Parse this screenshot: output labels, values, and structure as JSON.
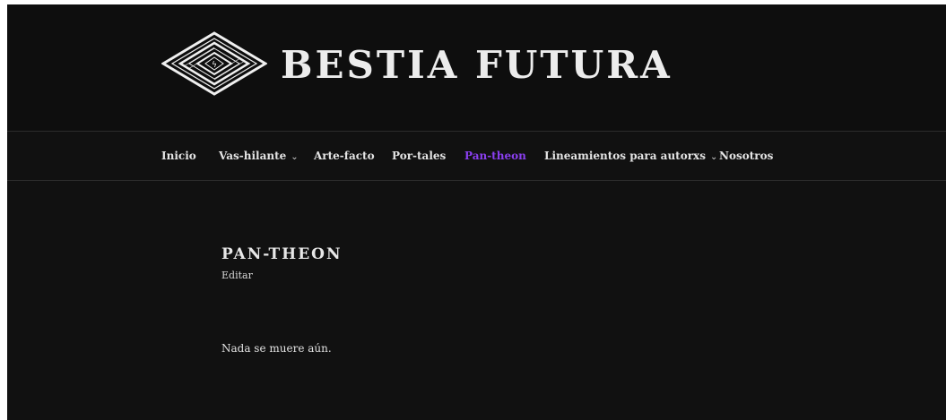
{
  "site": {
    "title": "BESTIA FUTURA",
    "logo_icon": "diamond-spiral-logo"
  },
  "nav": {
    "items": [
      {
        "label": "Inicio",
        "has_dropdown": false,
        "active": false
      },
      {
        "label": "Vas-hilante",
        "has_dropdown": true,
        "active": false
      },
      {
        "label": "Arte-facto",
        "has_dropdown": false,
        "active": false
      },
      {
        "label": "Por-tales",
        "has_dropdown": false,
        "active": false
      },
      {
        "label": "Pan-theon",
        "has_dropdown": false,
        "active": true
      },
      {
        "label": "Lineamientos para autorxs",
        "has_dropdown": true,
        "active": false
      },
      {
        "label": "Nosotros",
        "has_dropdown": false,
        "active": false
      }
    ],
    "dropdown_icon": "chevron-down-icon",
    "active_color": "#8a3ff0"
  },
  "page": {
    "title": "PAN-THEON",
    "edit_label": "Editar",
    "body_text": "Nada se muere aún."
  },
  "colors": {
    "background": "#111111",
    "text": "#e4e4e4",
    "accent": "#8a3ff0"
  }
}
